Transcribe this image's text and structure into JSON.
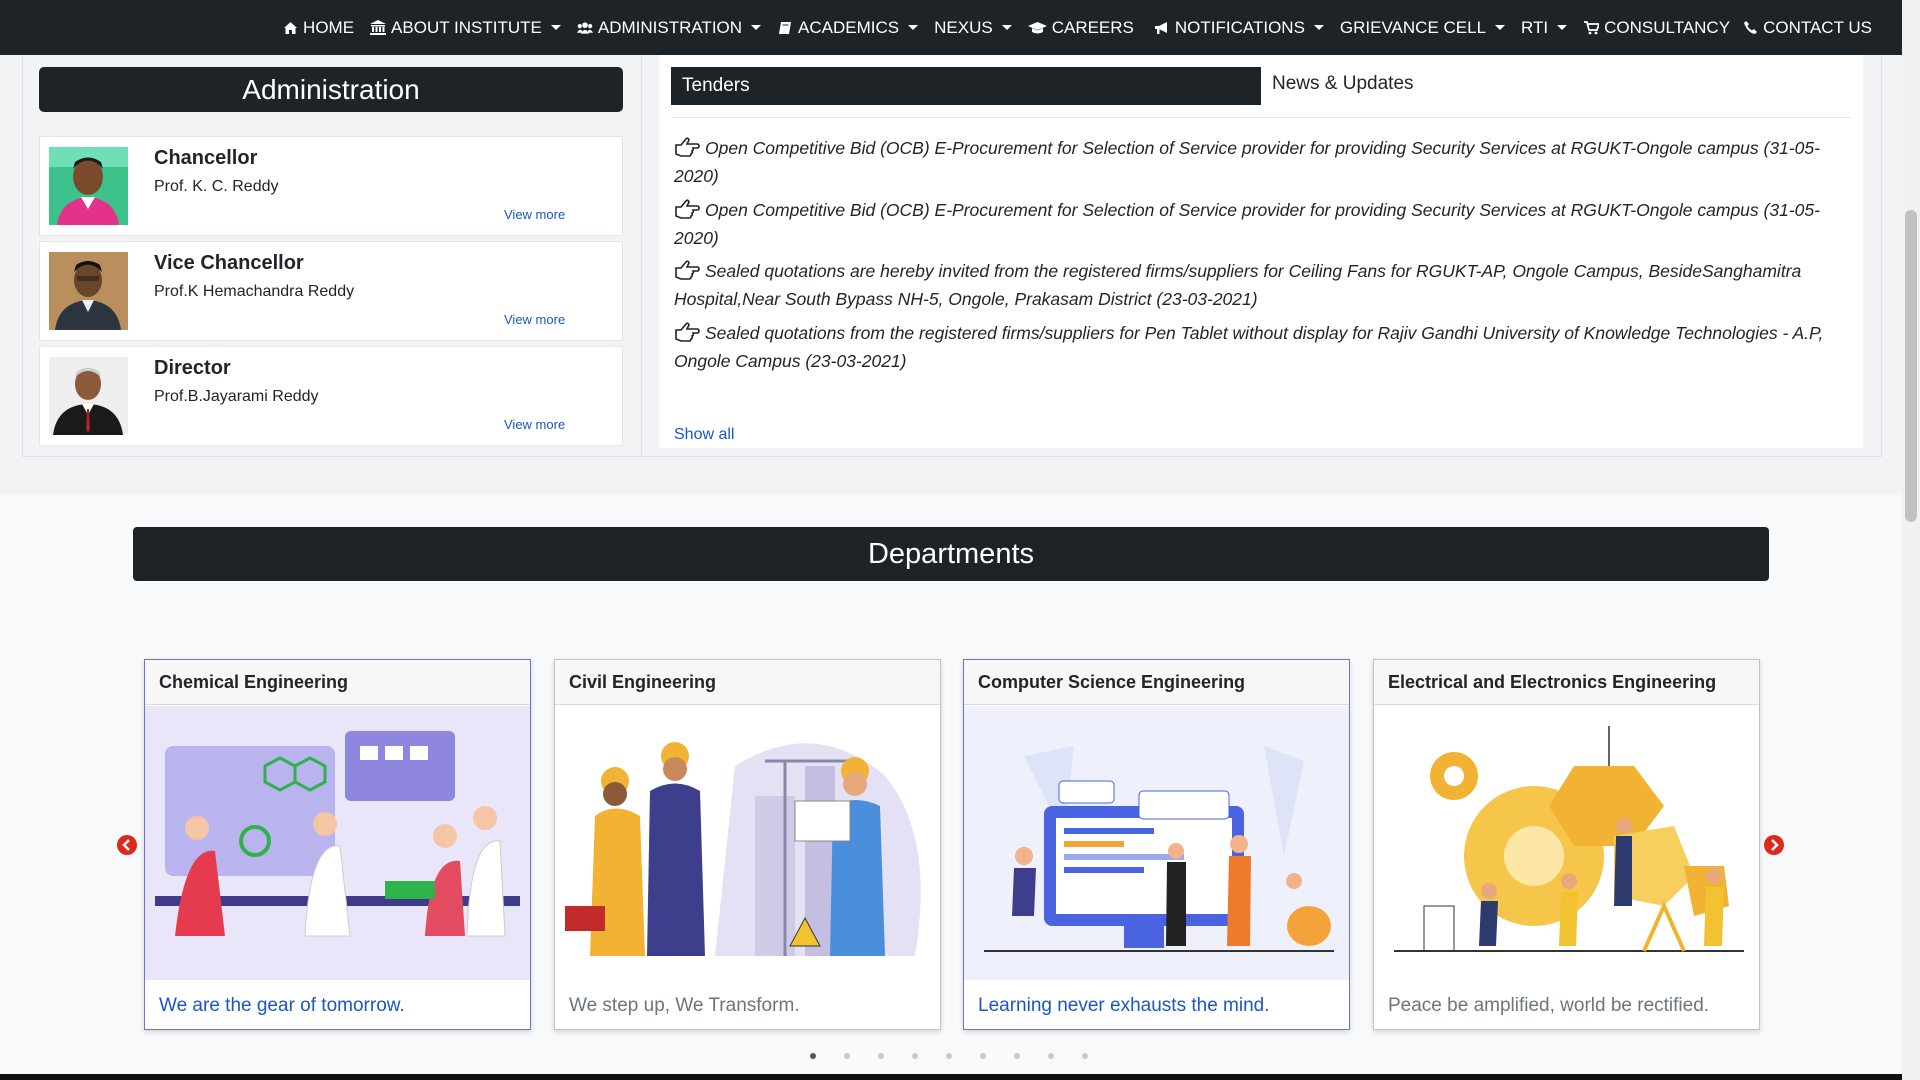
{
  "nav": {
    "items": [
      {
        "label": "HOME",
        "icon": "home-icon",
        "dropdown": false
      },
      {
        "label": "ABOUT INSTITUTE",
        "icon": "institution-icon",
        "dropdown": true
      },
      {
        "label": "ADMINISTRATION",
        "icon": "users-icon",
        "dropdown": true
      },
      {
        "label": "ACADEMICS",
        "icon": "book-icon",
        "dropdown": true
      },
      {
        "label": "NEXUS",
        "icon": "",
        "dropdown": true
      },
      {
        "label": "CAREERS",
        "icon": "graduation-cap-icon",
        "dropdown": false
      },
      {
        "label": "NOTIFICATIONS",
        "icon": "bullhorn-icon",
        "dropdown": true
      },
      {
        "label": "GRIEVANCE CELL",
        "icon": "",
        "dropdown": true
      },
      {
        "label": "RTI",
        "icon": "",
        "dropdown": true
      },
      {
        "label": "CONSULTANCY",
        "icon": "cart-icon",
        "dropdown": false
      },
      {
        "label": "CONTACT US",
        "icon": "phone-icon",
        "dropdown": false
      }
    ]
  },
  "administration": {
    "heading": "Administration",
    "people": [
      {
        "role": "Chancellor",
        "name": "Prof. K. C. Reddy",
        "link": "View more"
      },
      {
        "role": "Vice Chancellor",
        "name": "Prof.K Hemachandra Reddy",
        "link": "View more"
      },
      {
        "role": "Director",
        "name": "Prof.B.Jayarami Reddy",
        "link": "View more"
      }
    ]
  },
  "news": {
    "tab_active": "Tenders",
    "tab_other": "News & Updates",
    "items": [
      "Open Competitive Bid (OCB) E-Procurement for Selection of Service provider for providing Security Services at RGUKT-Ongole campus (31-05-2020)",
      "Open Competitive Bid (OCB) E-Procurement for Selection of Service provider for providing Security Services at RGUKT-Ongole campus (31-05-2020)",
      "Sealed quotations are hereby invited from the registered firms/suppliers for Ceiling Fans for RGUKT-AP, Ongole Campus, BesideSanghamitra Hospital,Near South Bypass NH-5, Ongole, Prakasam District (23-03-2021)",
      "Sealed quotations from the registered firms/suppliers for Pen Tablet without display for Rajiv Gandhi University of Knowledge Technologies - A.P, Ongole Campus   (23-03-2021)"
    ],
    "show_all": "Show all"
  },
  "departments": {
    "heading": "Departments",
    "cards": [
      {
        "title": "Chemical Engineering",
        "tagline": "We are the gear of tomorrow.",
        "active": true
      },
      {
        "title": "Civil Engineering",
        "tagline": "We step up, We Transform.",
        "active": false
      },
      {
        "title": "Computer Science Engineering",
        "tagline": "Learning never exhausts the mind.",
        "active": true
      },
      {
        "title": "Electrical and Electronics Engineering",
        "tagline": "Peace be amplified, world be rectified.",
        "active": false
      }
    ],
    "carousel_pages": 9,
    "carousel_current": 1
  },
  "colors": {
    "nav_bg": "#1e2328",
    "link": "#1a56c7",
    "arrow": "#e0271c"
  }
}
